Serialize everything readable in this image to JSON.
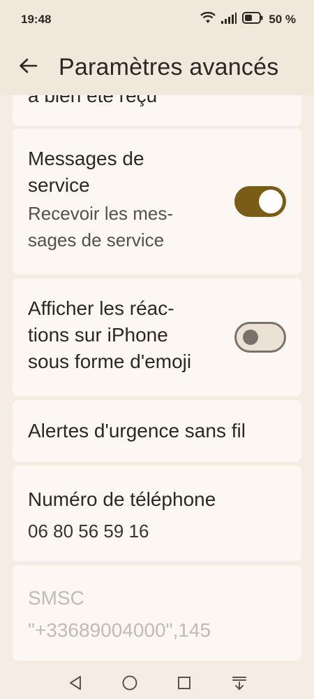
{
  "status": {
    "time": "19:48",
    "battery": "50 %"
  },
  "appbar": {
    "title": "Paramètres avancés"
  },
  "cards": {
    "partial": {
      "text": "a bien été reçu"
    },
    "service": {
      "title_line1": "Messages de",
      "title_line2": "service",
      "sub_line1": "Recevoir les mes-",
      "sub_line2": "sages de service",
      "toggle_on": true
    },
    "reactions": {
      "line1": "Afficher les réac-",
      "line2": "tions sur iPhone",
      "line3": "sous forme d'emoji",
      "toggle_on": false
    },
    "alerts": {
      "title": "Alertes d'urgence sans fil"
    },
    "phone": {
      "title": "Numéro de téléphone",
      "value": "06 80 56 59 16"
    },
    "smsc": {
      "title": "SMSC",
      "value": "\"+33689004000\",145"
    }
  },
  "icons": [
    "back-arrow-icon",
    "wifi-icon",
    "signal-icon",
    "battery-icon",
    "nav-back-icon",
    "nav-home-icon",
    "nav-recents-icon",
    "nav-menu-icon"
  ],
  "colors": {
    "accent": "#7a5c16",
    "background": "#f4ede4",
    "card": "#fcf7f2"
  }
}
